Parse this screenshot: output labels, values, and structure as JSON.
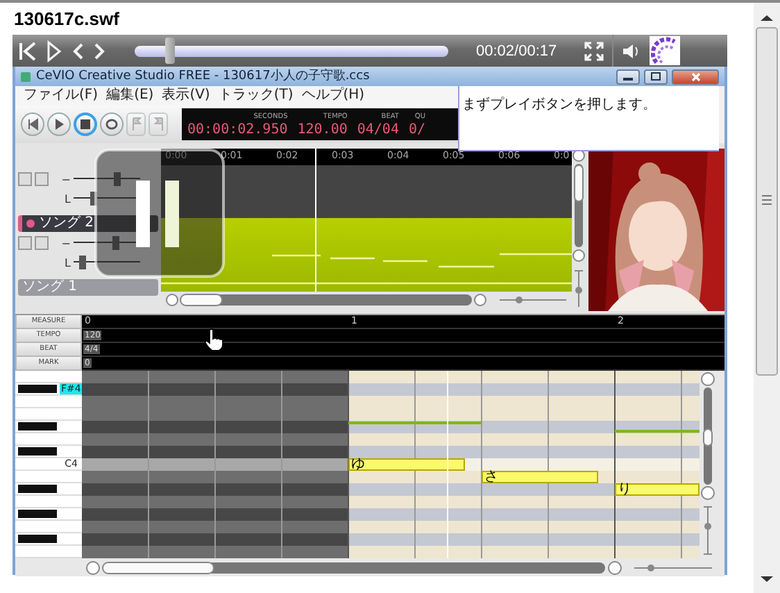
{
  "page_title": "130617c.swf",
  "player": {
    "seek": {
      "level": 0.11
    },
    "time": "00:02/00:17",
    "paused": true
  },
  "app": {
    "window_title": "CeVIO Creative Studio FREE - 130617小人の子守歌.ccs",
    "menu": [
      "ファイル(F)",
      "編集(E)",
      "表示(V)",
      "トラック(T)",
      "ヘルプ(H)"
    ],
    "message": "まずプレイボタンを押します。",
    "transport": [
      {
        "kind": "rewind",
        "selected": false,
        "disabled": false
      },
      {
        "kind": "play",
        "selected": false,
        "disabled": false
      },
      {
        "kind": "stop",
        "selected": true,
        "disabled": false
      },
      {
        "kind": "loop",
        "selected": false,
        "disabled": false
      },
      {
        "kind": "flag-left",
        "selected": false,
        "disabled": true
      },
      {
        "kind": "flag-right",
        "selected": false,
        "disabled": true
      }
    ],
    "lcd": [
      {
        "label": "SECONDS",
        "value": "00:00:02.950"
      },
      {
        "label": "TEMPO",
        "value": "120.00"
      },
      {
        "label": "BEAT",
        "value": "04/04"
      },
      {
        "label": "QU",
        "value": "0/"
      }
    ],
    "tracks": {
      "ruler": [
        "0:00",
        "0:01",
        "0:02",
        "0:03",
        "0:04",
        "0:05",
        "0:06",
        "0:0"
      ],
      "playhead": {
        "level": 0.375
      },
      "items": [
        {
          "volume_label": "−",
          "volume": {
            "level": 0.65
          },
          "pan_label": "L",
          "pan": {
            "level": 0.3
          }
        },
        {
          "name": "ソング 2",
          "selected": true,
          "volume_label": "−",
          "volume": {
            "level": 0.62
          },
          "pan_label": "L",
          "pan": {
            "level": 0.12
          }
        },
        {
          "name": "ソング 1",
          "selected": false
        }
      ]
    },
    "piano_roll": {
      "header_labels": [
        "MEASURE",
        "TEMPO",
        "BEAT",
        "MARK"
      ],
      "measures": [
        "0",
        "1",
        "2"
      ],
      "tempo": "120",
      "beat": "4/4",
      "mark": "0",
      "key_labels": [
        {
          "text": "F#4",
          "highlighted": true
        },
        {
          "text": "C4",
          "highlighted": false
        }
      ],
      "playhead": {
        "level": 0.59
      },
      "notes": [
        {
          "lyric": "ゆ"
        },
        {
          "lyric": "さ"
        },
        {
          "lyric": "り"
        }
      ]
    }
  }
}
